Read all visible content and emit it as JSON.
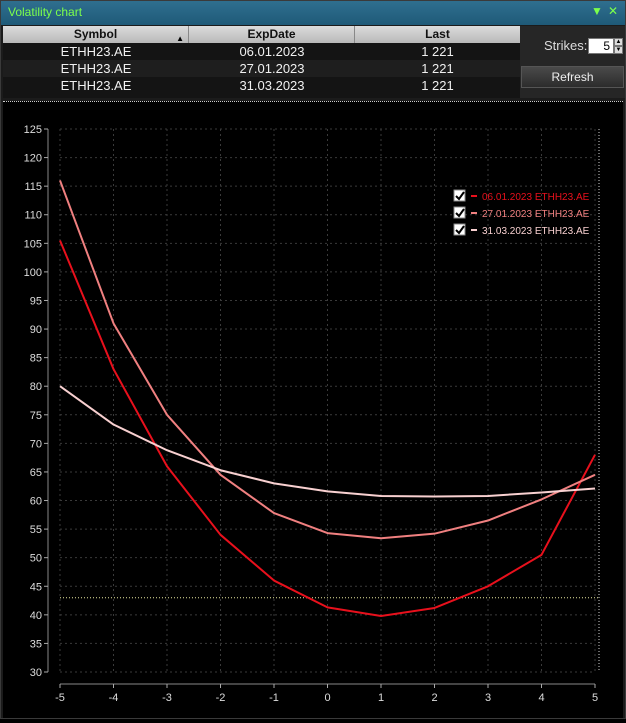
{
  "window": {
    "title": "Volatility chart",
    "minimize_icon": "triangle-down-icon",
    "close_icon": "close-icon"
  },
  "table": {
    "columns": [
      "Symbol",
      "ExpDate",
      "Last"
    ],
    "rows": [
      [
        "ETHH23.AE",
        "06.01.2023",
        "1 221"
      ],
      [
        "ETHH23.AE",
        "27.01.2023",
        "1 221"
      ],
      [
        "ETHH23.AE",
        "31.03.2023",
        "1 221"
      ]
    ]
  },
  "controls": {
    "strikes_label": "Strikes:",
    "strikes_value": "5",
    "refresh_label": "Refresh"
  },
  "chart_data": {
    "type": "line",
    "x": [
      -5,
      -4,
      -3,
      -2,
      -1,
      0,
      1,
      2,
      3,
      4,
      5
    ],
    "xlim": [
      -5,
      5
    ],
    "ylim": [
      30,
      125
    ],
    "yticks": [
      30,
      35,
      40,
      45,
      50,
      55,
      60,
      65,
      70,
      75,
      80,
      85,
      90,
      95,
      100,
      105,
      110,
      115,
      120,
      125
    ],
    "xticks": [
      -5,
      -4,
      -3,
      -2,
      -1,
      0,
      1,
      2,
      3,
      4,
      5
    ],
    "grid": true,
    "legend_position": "top-right",
    "reference_line_y": 43,
    "series": [
      {
        "name": "06.01.2023 ETHH23.AE",
        "color": "#e8101c",
        "values": [
          105.5,
          83.0,
          66.0,
          54.0,
          46.0,
          41.3,
          39.8,
          41.2,
          45.0,
          50.5,
          68.0
        ]
      },
      {
        "name": "27.01.2023 ETHH23.AE",
        "color": "#f08080",
        "values": [
          116.0,
          91.0,
          75.0,
          64.5,
          57.8,
          54.3,
          53.4,
          54.2,
          56.5,
          60.2,
          64.5
        ]
      },
      {
        "name": "31.03.2023 ETHH23.AE",
        "color": "#f8d0d0",
        "values": [
          80.0,
          73.3,
          68.8,
          65.3,
          63.0,
          61.6,
          60.8,
          60.7,
          60.8,
          61.4,
          62.1
        ]
      }
    ]
  }
}
